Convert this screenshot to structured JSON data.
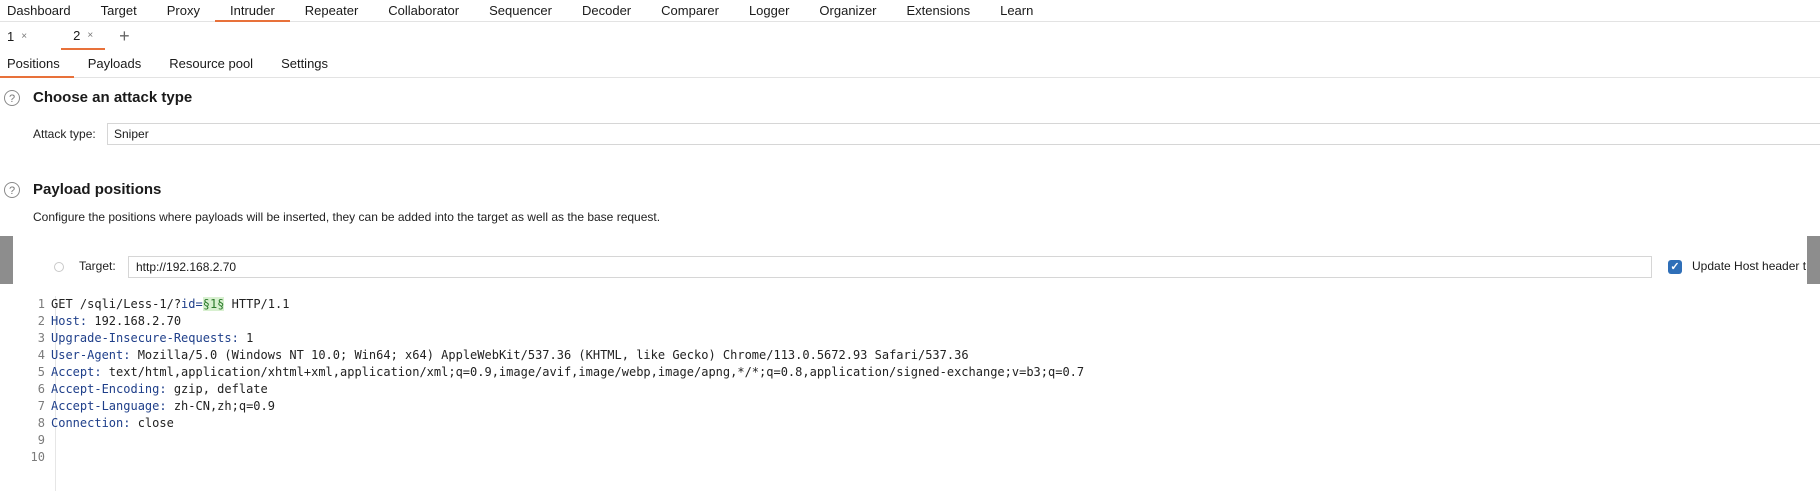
{
  "top_nav": [
    "Dashboard",
    "Target",
    "Proxy",
    "Intruder",
    "Repeater",
    "Collaborator",
    "Sequencer",
    "Decoder",
    "Comparer",
    "Logger",
    "Organizer",
    "Extensions",
    "Learn"
  ],
  "top_nav_active": "Intruder",
  "request_tabs": [
    {
      "label": "1",
      "close": "×"
    },
    {
      "label": "2",
      "close": "×"
    }
  ],
  "add_tab_symbol": "+",
  "sub_tabs": [
    "Positions",
    "Payloads",
    "Resource pool",
    "Settings"
  ],
  "sub_tab_active": "Positions",
  "attack_section": {
    "help": "?",
    "title": "Choose an attack type",
    "type_label": "Attack type:",
    "type_value": "Sniper"
  },
  "payload_section": {
    "help": "?",
    "title": "Payload positions",
    "description": "Configure the positions where payloads will be inserted, they can be added into the target as well as the base request.",
    "target_label": "Target:",
    "target_value": "http://192.168.2.70",
    "update_host_label": "Update Host header t",
    "update_host_checked": true,
    "checkmark": "✓"
  },
  "request_lines": [
    {
      "num": "1",
      "pre": "GET /sqli/Less-1/?",
      "param": "id=",
      "payload": "§1§",
      "post": " HTTP/1.1"
    },
    {
      "num": "2",
      "key": "Host:",
      "val": " 192.168.2.70"
    },
    {
      "num": "3",
      "key": "Upgrade-Insecure-Requests:",
      "val": " 1"
    },
    {
      "num": "4",
      "key": "User-Agent:",
      "val": " Mozilla/5.0 (Windows NT 10.0; Win64; x64) AppleWebKit/537.36 (KHTML, like Gecko) Chrome/113.0.5672.93 Safari/537.36"
    },
    {
      "num": "5",
      "key": "Accept:",
      "val": " text/html,application/xhtml+xml,application/xml;q=0.9,image/avif,image/webp,image/apng,*/*;q=0.8,application/signed-exchange;v=b3;q=0.7"
    },
    {
      "num": "6",
      "key": "Accept-Encoding:",
      "val": " gzip, deflate"
    },
    {
      "num": "7",
      "key": "Accept-Language:",
      "val": " zh-CN,zh;q=0.9"
    },
    {
      "num": "8",
      "key": "Connection:",
      "val": " close"
    },
    {
      "num": "9"
    },
    {
      "num": "10"
    }
  ],
  "colors": {
    "accent": "#e8713a",
    "checkbox": "#2f6fb8",
    "header_key": "#1f3f8a",
    "payload_marker": "#d8f0d0"
  }
}
